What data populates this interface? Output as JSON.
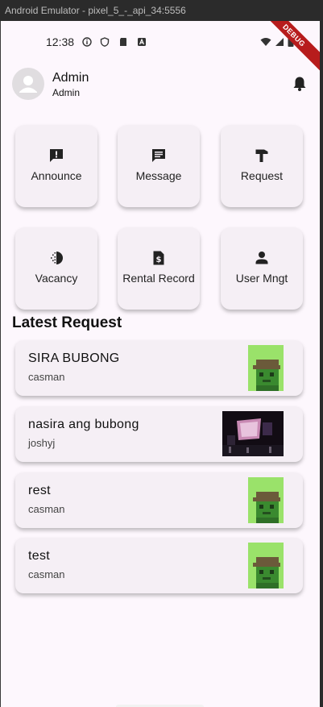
{
  "window": {
    "title": "Android Emulator - pixel_5_-_api_34:5556"
  },
  "status_bar": {
    "time": "12:38",
    "debug_banner": "DEBUG"
  },
  "header": {
    "name": "Admin",
    "role": "Admin"
  },
  "menu": [
    {
      "label": "Announce",
      "icon": "announcement-icon"
    },
    {
      "label": "Message",
      "icon": "message-icon"
    },
    {
      "label": "Request",
      "icon": "hammer-icon"
    },
    {
      "label": "Vacancy",
      "icon": "vacancy-icon"
    },
    {
      "label": "Rental Record",
      "icon": "dollar-doc-icon"
    },
    {
      "label": "User Mngt",
      "icon": "person-icon"
    }
  ],
  "latest_request": {
    "title": "Latest Request",
    "items": [
      {
        "title": "SIRA BUBONG",
        "user": "casman",
        "thumb": "pixel-avatar"
      },
      {
        "title": "nasira ang bubong",
        "user": "joshyj",
        "thumb": "photo"
      },
      {
        "title": "rest",
        "user": "casman",
        "thumb": "pixel-avatar"
      },
      {
        "title": "test",
        "user": "casman",
        "thumb": "pixel-avatar"
      }
    ]
  },
  "colors": {
    "background": "#fdf7fd",
    "card": "#f5eff5",
    "debug": "#b71c1c"
  }
}
